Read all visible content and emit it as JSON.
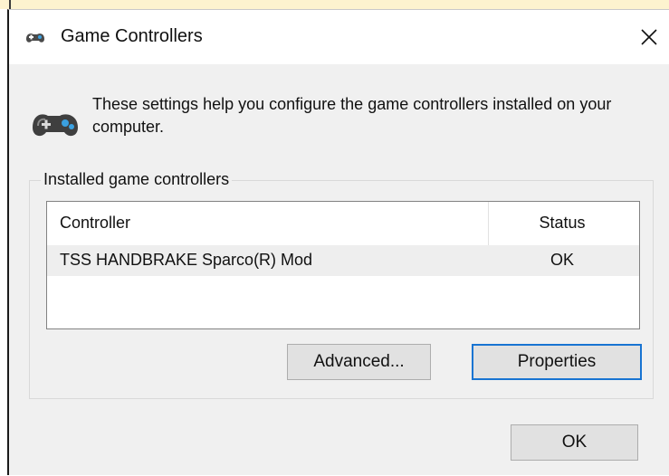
{
  "window": {
    "title": "Game Controllers",
    "icon": "gamepad-icon",
    "close_icon": "close-icon"
  },
  "intro": {
    "text": "These settings help you configure the game controllers installed on your computer.",
    "icon": "gamepad-icon"
  },
  "installed_group": {
    "legend": "Installed game controllers",
    "columns": {
      "controller": "Controller",
      "status": "Status"
    },
    "rows": [
      {
        "controller": "TSS HANDBRAKE Sparco(R) Mod",
        "status": "OK"
      }
    ]
  },
  "buttons": {
    "advanced": "Advanced...",
    "properties": "Properties",
    "ok": "OK"
  },
  "colors": {
    "dialog_bg": "#f0f0f0",
    "titlebar_bg": "#ffffff",
    "focus_border": "#1874d2",
    "selected_row_bg": "#eeeeee"
  }
}
